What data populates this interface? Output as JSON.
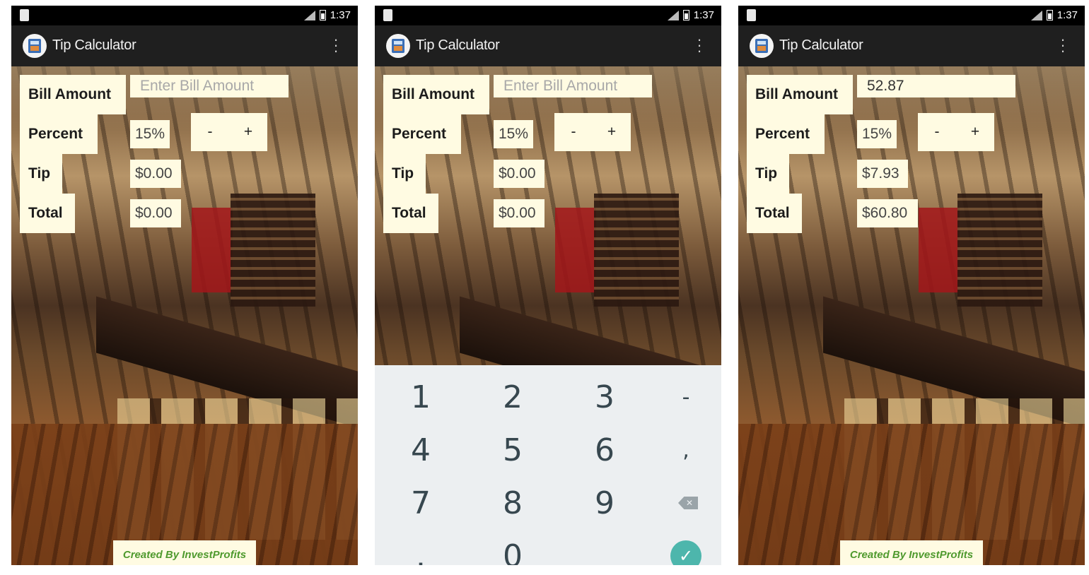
{
  "status": {
    "time": "1:37"
  },
  "app": {
    "title": "Tip Calculator",
    "overflow_icon": "more-vert-icon"
  },
  "labels": {
    "bill": "Bill Amount",
    "percent": "Percent",
    "tip": "Tip",
    "total": "Total"
  },
  "stepper": {
    "minus": "-",
    "plus": "+"
  },
  "credit": "Created By InvestProfits",
  "screens": [
    {
      "bill_placeholder": "Enter Bill Amount",
      "bill_value": "",
      "percent": "15%",
      "tip": "$0.00",
      "total": "$0.00"
    },
    {
      "bill_placeholder": "Enter Bill Amount",
      "bill_value": "",
      "percent": "15%",
      "tip": "$0.00",
      "total": "$0.00"
    },
    {
      "bill_placeholder": "Enter Bill Amount",
      "bill_value": "52.87",
      "percent": "15%",
      "tip": "$7.93",
      "total": "$60.80"
    }
  ],
  "keypad": {
    "rows": [
      [
        "1",
        "2",
        "3",
        "-"
      ],
      [
        "4",
        "5",
        "6",
        ","
      ],
      [
        "7",
        "8",
        "9",
        "backspace"
      ],
      [
        ".",
        "0",
        "",
        "done"
      ]
    ],
    "backspace_icon": "backspace-icon",
    "done_icon": "check-icon"
  },
  "colors": {
    "panel_bg": "#fffbe2",
    "appbar": "#1f1f1f",
    "keypad_bg": "#eceff1",
    "accent": "#4db6ac",
    "credit_text": "#4f9a2e"
  }
}
